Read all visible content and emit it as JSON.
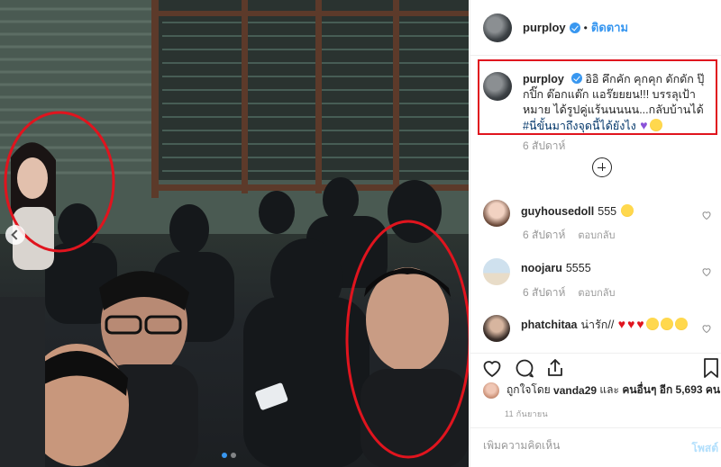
{
  "post": {
    "username": "purploy",
    "follow_label": "ติดตาม",
    "dot": "•",
    "caption_username": "purploy",
    "caption_text": "อิอิ คึกคัก คุกคุก ดักดัก ปุ๊กปิ๊ก ต๊อกแต๊ก แอร๊ยยยน!!! บรรลุเป้าหมาย ได้รูปคู่แร้นนนนน...กลับบ้านได้",
    "caption_hashtag": "#นี่ขั้นมาถึงจุดนี้ได้ยังไง",
    "caption_time": "6 สัปดาห์"
  },
  "comments": [
    {
      "username": "guyhousedoll",
      "text": "555",
      "time": "6 สัปดาห์",
      "reply": "ตอบกลับ"
    },
    {
      "username": "noojaru",
      "text": "5555",
      "time": "6 สัปดาห์",
      "reply": "ตอบกลับ"
    },
    {
      "username": "phatchitaa",
      "text": "น่ารัก//"
    }
  ],
  "likes": {
    "prefix": "ถูกใจโดย",
    "user": "vanda29",
    "and": "และ",
    "others": "คนอื่นๆ อีก 5,693 คน"
  },
  "date": "11 กันยายน",
  "add_comment": {
    "placeholder": "เพิ่มความคิดเห็น",
    "post_label": "โพสต์"
  },
  "icons": {
    "verified": "verified-badge-icon",
    "load_more": "plus-circle-icon",
    "like": "heart-icon",
    "comment": "speech-bubble-icon",
    "share": "share-icon",
    "save": "bookmark-icon"
  },
  "colors": {
    "accent": "#3897f0",
    "highlight": "#e0141e"
  }
}
